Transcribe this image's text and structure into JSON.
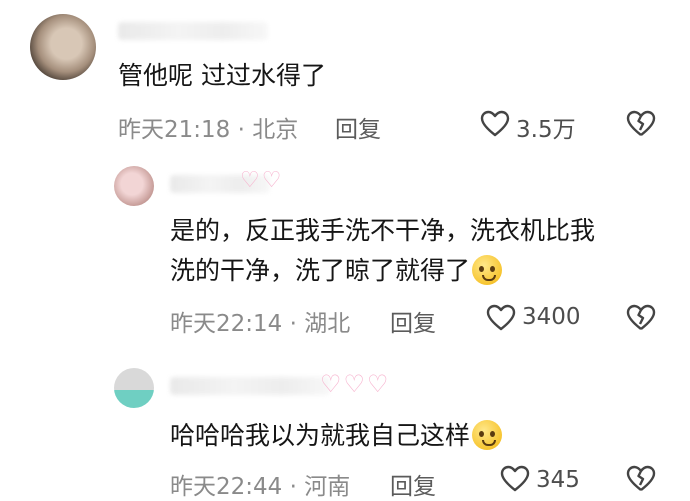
{
  "comments": [
    {
      "text": "管他呢 过过水得了",
      "meta": "昨天21:18 · 北京",
      "reply_label": "回复",
      "like_count": "3.5万"
    },
    {
      "line1": "是的，反正我手洗不干净，洗衣机比我",
      "line2": "洗的干净，洗了晾了就得了",
      "emoji": "pleading-face-emoji",
      "meta": "昨天22:14 · 湖北",
      "reply_label": "回复",
      "like_count": "3400"
    },
    {
      "text": "哈哈哈我以为就我自己这样",
      "emoji": "pleading-face-emoji",
      "meta": "昨天22:44 · 河南",
      "reply_label": "回复",
      "like_count": "345"
    }
  ],
  "icons": {
    "like": "heart-outline-icon",
    "dislike": "broken-heart-icon"
  },
  "colors": {
    "meta": "#8a8a8a",
    "text": "#161616",
    "icon": "#444444"
  }
}
